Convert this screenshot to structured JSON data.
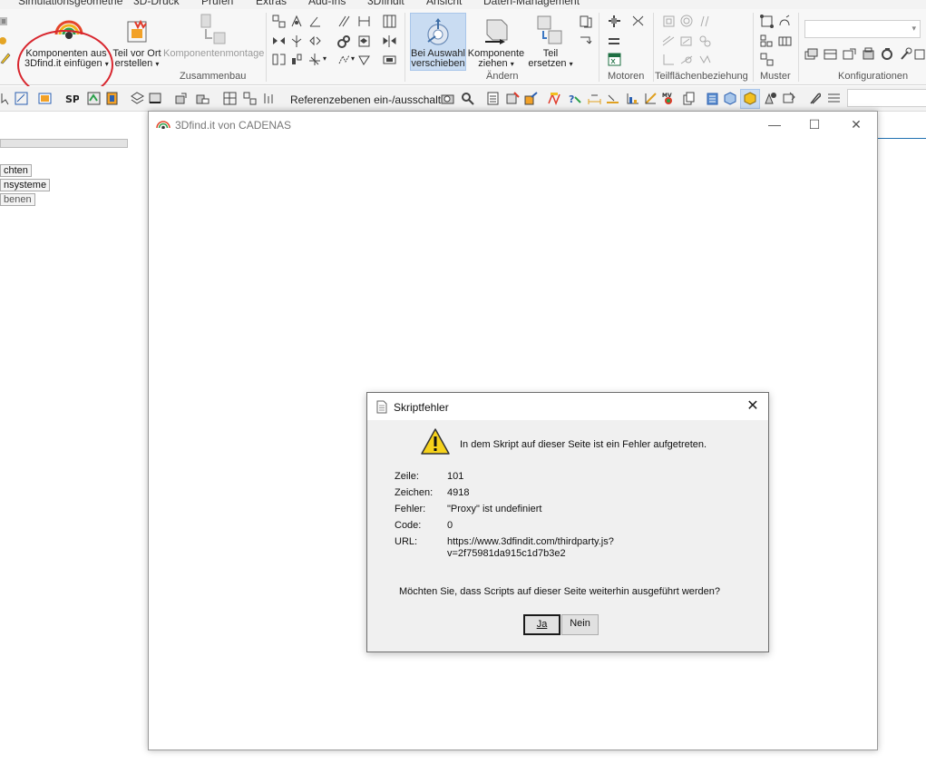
{
  "ribbon_tabs": [
    "Simulationsgeometrie",
    "3D-Druck",
    "Prüfen",
    "Extras",
    "Add-Ins",
    "3Dfindit",
    "Ansicht",
    "Daten-Management"
  ],
  "ribbon": {
    "insert_components": {
      "line1": "Komponenten aus",
      "line2": "3Dfind.it einfügen"
    },
    "part_in_place": {
      "line1": "Teil vor Ort",
      "line2": "erstellen"
    },
    "component_assembly": "Komponentenmontage",
    "move_on_selection": {
      "line1": "Bei Auswahl",
      "line2": "verschieben"
    },
    "drag_component": {
      "line1": "Komponente",
      "line2": "ziehen"
    },
    "replace_part": {
      "line1": "Teil",
      "line2": "ersetzen"
    },
    "groups": {
      "assembly": "Zusammenbau",
      "modify": "Ändern",
      "motors": "Motoren",
      "face_relation": "Teilflächenbeziehung",
      "pattern": "Muster",
      "configurations": "Konfigurationen"
    }
  },
  "toolbar2": {
    "ref_planes_toggle": "Referenzebenen ein-/ausschalten"
  },
  "tree": {
    "items": [
      "chten",
      "nsysteme",
      "benen"
    ]
  },
  "window3d": {
    "title": "3Dfind.it von CADENAS",
    "controls": {
      "minimize": "—",
      "maximize": "☐",
      "close": "✕"
    }
  },
  "dialog": {
    "title": "Skriptfehler",
    "close": "✕",
    "message": "In dem Skript auf dieser Seite ist ein Fehler aufgetreten.",
    "fields": [
      {
        "key": "Zeile:",
        "value": "101"
      },
      {
        "key": "Zeichen:",
        "value": "4918"
      },
      {
        "key": "Fehler:",
        "value": "\"Proxy\" ist undefiniert"
      },
      {
        "key": "Code:",
        "value": "0"
      },
      {
        "key": "URL:",
        "value": "https://www.3dfindit.com/thirdparty.js?",
        "value2": "v=2f75981da915c1d7b3e2"
      }
    ],
    "question": "Möchten Sie, dass Scripts auf dieser Seite weiterhin ausgeführt werden?",
    "yes": "Ja",
    "no": "Nein"
  },
  "colors": {
    "highlight": "#c9dcf2",
    "annotation": "#d8262e",
    "warning": "#f6d21b"
  }
}
